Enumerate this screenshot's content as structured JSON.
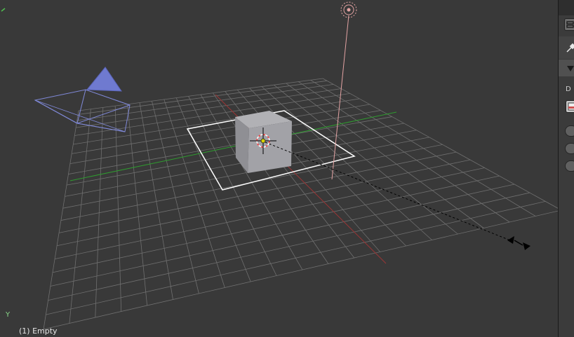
{
  "viewport": {
    "status_text": "(1) Empty",
    "axis_label": "Y",
    "grid_color": "#6f6f6f",
    "x_axis_color": "#a33a3a",
    "y_axis_color": "#3a9a3a",
    "background": "#393939",
    "camera_color": "#7a85d6",
    "cube_color": "#9a9a9e",
    "selection_color": "#ffffff",
    "lamp_line_color": "#e0a0a0"
  },
  "side_panel": {
    "truncated_label": "D",
    "icons": [
      "properties-icon",
      "pin-icon",
      "collapse-arrow-icon",
      "texture-icon"
    ]
  }
}
